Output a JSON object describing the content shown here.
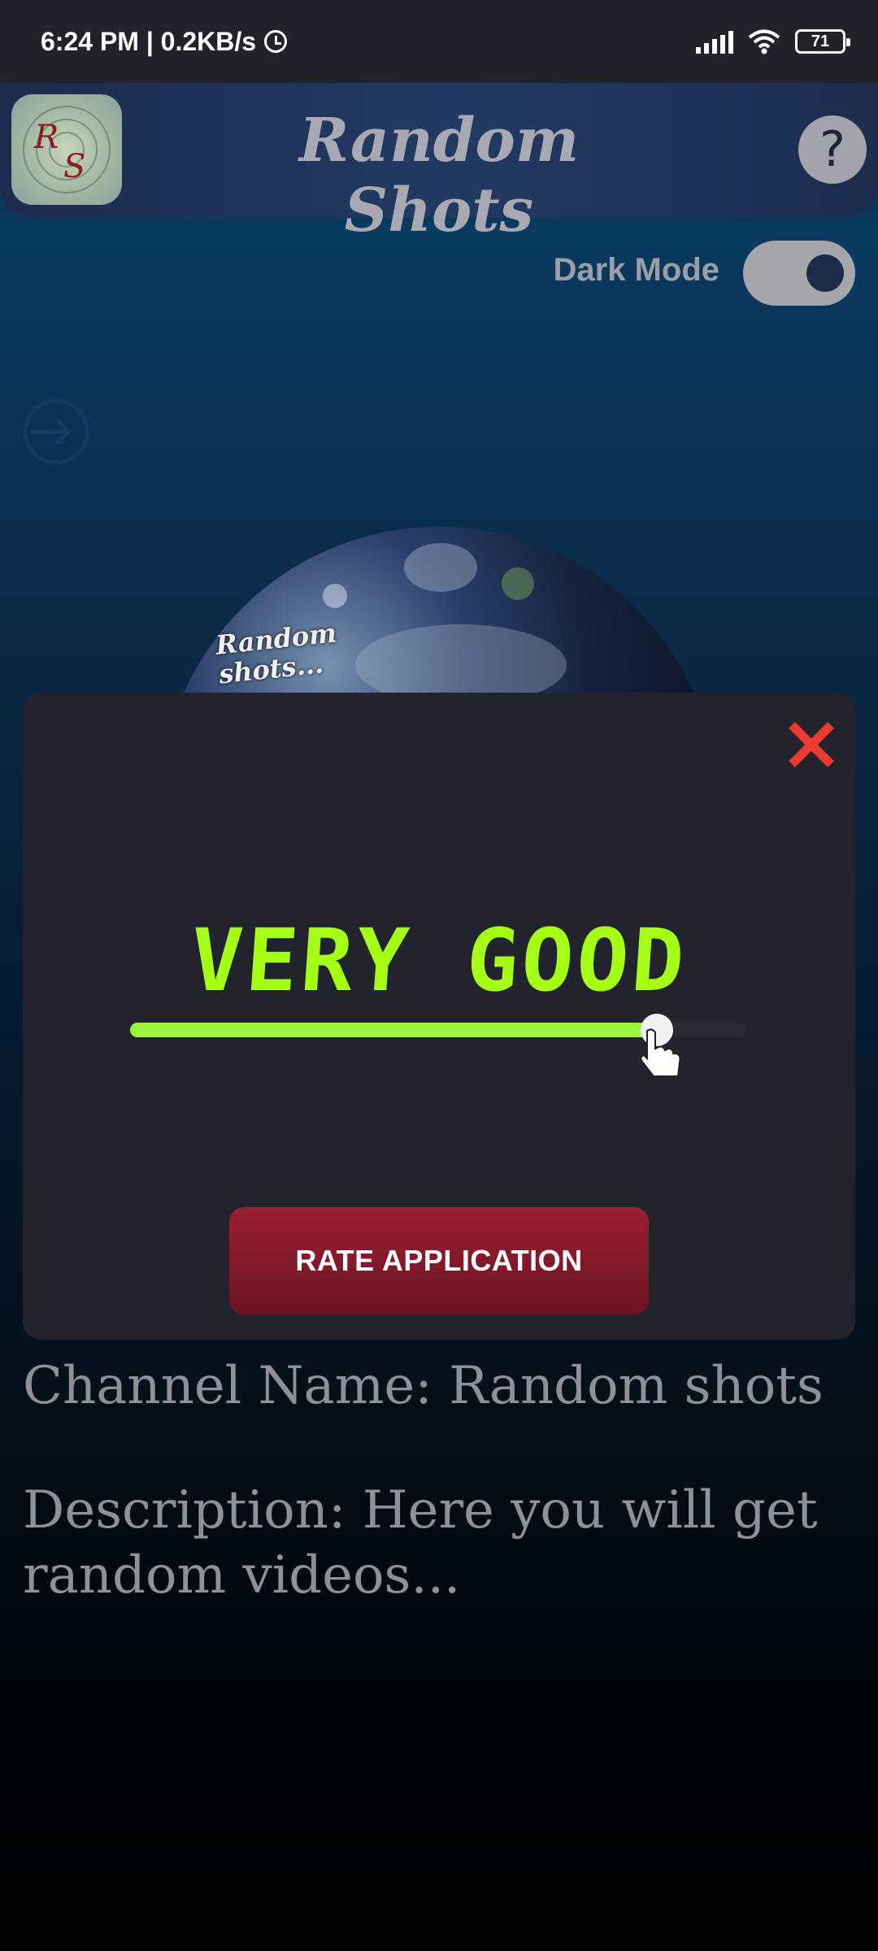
{
  "status_bar": {
    "time_speed": "6:24 PM | 0.2KB/s",
    "battery": "71"
  },
  "header": {
    "title": "Random Shots",
    "logo_letters": [
      "R",
      "S"
    ],
    "help_label": "?"
  },
  "dark_mode": {
    "label": "Dark Mode",
    "enabled": true
  },
  "channel_image": {
    "caption_line1": "Random",
    "caption_line2": "shots..."
  },
  "rating_dialog": {
    "rating_label": "VERY GOOD",
    "rating_color": "#a4ff14",
    "slider_value_fraction": 0.84,
    "button_label": "RATE APPLICATION",
    "close_icon": "close-icon"
  },
  "channel_info": {
    "name": "Channel Name: Random shots",
    "description": "Description: Here you will get random videos..."
  },
  "colors": {
    "status_bar": "#22222c",
    "dialog_bg": "#23232d",
    "button": "#8a1a2c",
    "close": "#ee3b30"
  }
}
